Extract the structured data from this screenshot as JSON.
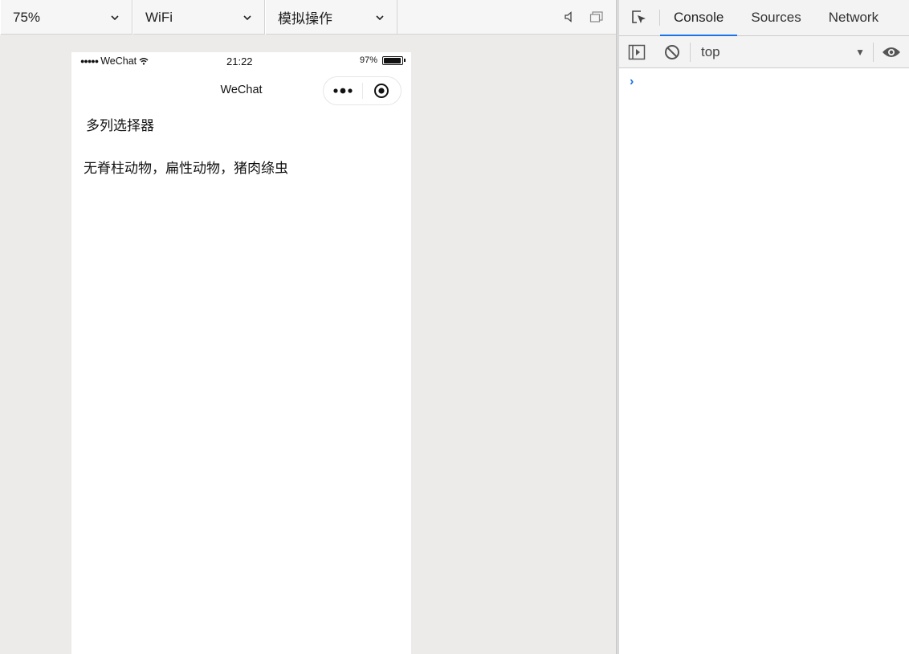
{
  "simulator": {
    "toolbar": {
      "zoom": "75%",
      "network": "WiFi",
      "operations": "模拟操作",
      "sound_icon": "speaker-icon",
      "window_icon": "detach-window-icon"
    },
    "phone": {
      "status_bar": {
        "signal": "●●●●●",
        "carrier": "WeChat",
        "time": "21:22",
        "battery_text": "97%",
        "battery_level": 0.97
      },
      "nav_title": "WeChat",
      "capsule": {
        "menu_icon": "more-dots-icon",
        "close_icon": "target-close-icon"
      },
      "content": {
        "title": "多列选择器",
        "picker_value": "无脊柱动物，扁性动物，猪肉绦虫"
      }
    }
  },
  "devtools": {
    "tabs": [
      "Console",
      "Sources",
      "Network"
    ],
    "active_tab": "Console",
    "context": "top",
    "prompt_symbol": "›",
    "accent_color": "#1a73e8"
  }
}
